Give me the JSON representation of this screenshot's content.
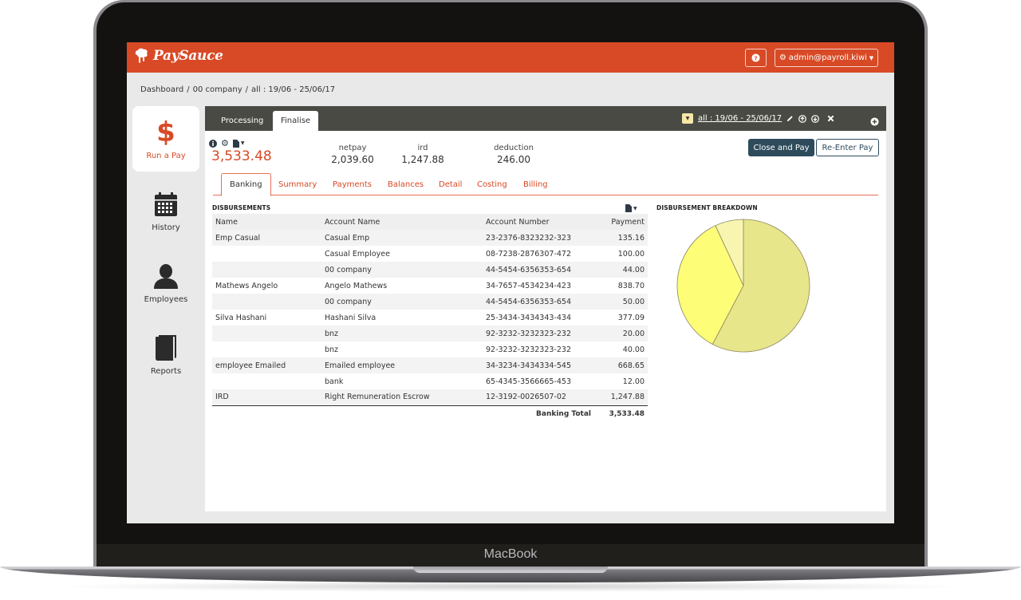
{
  "device": {
    "brand_label": "MacBook"
  },
  "app": {
    "brand": "PaySauce",
    "colors": {
      "brand": "#d84a26",
      "header_dark": "#4a4a44",
      "primary_button": "#2e4b5c"
    },
    "user_menu_label": "admin@payroll.kiwi",
    "help_icon": "question-circle-icon"
  },
  "breadcrumb": [
    "Dashboard",
    "/",
    "00 company",
    "/",
    "all : 19/06 - 25/06/17"
  ],
  "sidebar": {
    "items": [
      {
        "label": "Run a Pay",
        "icon": "dollar-icon",
        "active": true
      },
      {
        "label": "History",
        "icon": "calendar-icon",
        "active": false
      },
      {
        "label": "Employees",
        "icon": "user-icon",
        "active": false
      },
      {
        "label": "Reports",
        "icon": "book-icon",
        "active": false
      }
    ]
  },
  "main": {
    "top_tabs": [
      {
        "label": "Processing",
        "active": false
      },
      {
        "label": "Finalise",
        "active": true
      }
    ],
    "period_label": "all : 19/06 - 25/06/17",
    "total": "3,533.48",
    "stats": [
      {
        "label": "netpay",
        "value": "2,039.60"
      },
      {
        "label": "ird",
        "value": "1,247.88"
      },
      {
        "label": "deduction",
        "value": "246.00"
      }
    ],
    "buttons": {
      "close_and_pay": "Close and Pay",
      "re_enter_pay": "Re-Enter Pay"
    },
    "sub_tabs": [
      {
        "label": "Banking",
        "active": true
      },
      {
        "label": "Summary",
        "active": false
      },
      {
        "label": "Payments",
        "active": false
      },
      {
        "label": "Balances",
        "active": false
      },
      {
        "label": "Detail",
        "active": false
      },
      {
        "label": "Costing",
        "active": false
      },
      {
        "label": "Billing",
        "active": false
      }
    ]
  },
  "disbursements": {
    "title": "DISBURSEMENTS",
    "columns": [
      "Name",
      "Account Name",
      "Account Number",
      "Payment"
    ],
    "rows": [
      {
        "name": "Emp Casual",
        "account_name": "Casual Emp",
        "account_number": "23-2376-8323232-323",
        "payment": "135.16"
      },
      {
        "name": "",
        "account_name": "Casual Employee",
        "account_number": "08-7238-2876307-472",
        "payment": "100.00"
      },
      {
        "name": "",
        "account_name": "00 company",
        "account_number": "44-5454-6356353-654",
        "payment": "44.00"
      },
      {
        "name": "Mathews Angelo",
        "account_name": "Angelo Mathews",
        "account_number": "34-7657-4534234-423",
        "payment": "838.70"
      },
      {
        "name": "",
        "account_name": "00 company",
        "account_number": "44-5454-6356353-654",
        "payment": "50.00"
      },
      {
        "name": "Silva Hashani",
        "account_name": "Hashani Silva",
        "account_number": "25-3434-3434343-434",
        "payment": "377.09"
      },
      {
        "name": "",
        "account_name": "bnz",
        "account_number": "92-3232-3232323-232",
        "payment": "20.00"
      },
      {
        "name": "",
        "account_name": "bnz",
        "account_number": "92-3232-3232323-232",
        "payment": "40.00"
      },
      {
        "name": "employee Emailed",
        "account_name": "Emailed employee",
        "account_number": "34-3234-3434334-545",
        "payment": "668.65"
      },
      {
        "name": "",
        "account_name": "bank",
        "account_number": "65-4345-3566665-453",
        "payment": "12.00"
      },
      {
        "name": "IRD",
        "account_name": "Right Remuneration Escrow",
        "account_number": "12-3192-0026507-02",
        "payment": "1,247.88"
      }
    ],
    "total_label": "Banking Total",
    "total_value": "3,533.48"
  },
  "chart_data": {
    "type": "pie",
    "title": "DISBURSEMENT BREAKDOWN",
    "categories": [
      "netpay",
      "ird",
      "deduction"
    ],
    "values": [
      2039.6,
      1247.88,
      246.0
    ],
    "colors": [
      "#e8e68a",
      "#fdfd78",
      "#f7f5b0"
    ],
    "start": "top",
    "direction": "clockwise",
    "legend": "none"
  }
}
